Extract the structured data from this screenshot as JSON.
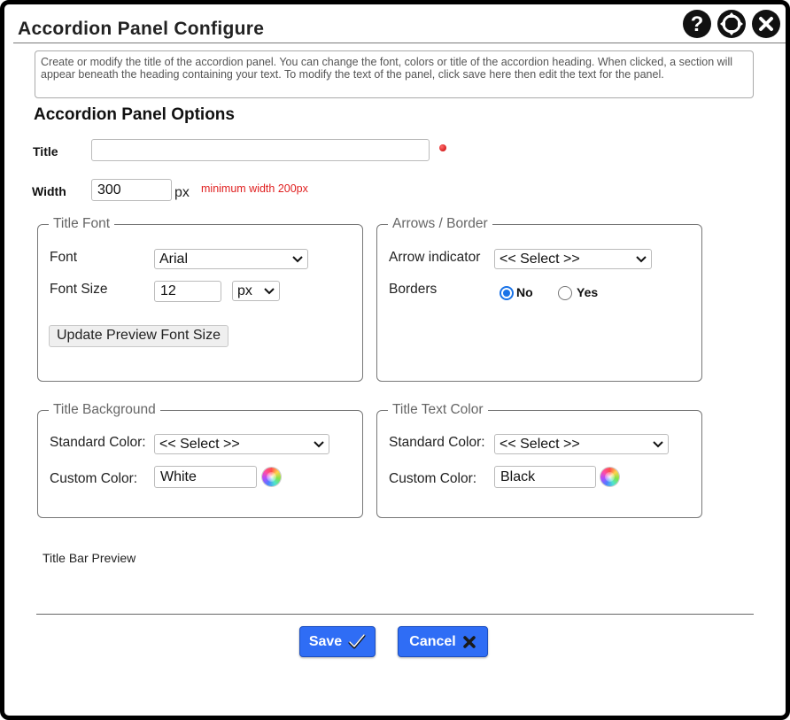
{
  "dialog": {
    "title": "Accordion Panel Configure",
    "header_icons": [
      "help-icon",
      "move-icon",
      "close-icon"
    ]
  },
  "info_text": "Create or modify the title of the accordion panel. You can change the font, colors or title of the accordion heading. When clicked, a section will appear beneath the heading containing your text. To modify the text of the panel, click save here then edit the text for the panel.",
  "options_heading": "Accordion Panel Options",
  "title_field": {
    "label": "Title",
    "value": ""
  },
  "width_field": {
    "label": "Width",
    "value": "300",
    "unit": "px",
    "hint": "minimum width 200px"
  },
  "title_font": {
    "legend": "Title Font",
    "font_label": "Font",
    "font_value": "Arial",
    "size_label": "Font Size",
    "size_value": "12",
    "size_unit": "px",
    "update_button": "Update Preview Font Size"
  },
  "arrows_border": {
    "legend": "Arrows / Border",
    "arrow_label": "Arrow indicator",
    "arrow_value": "<< Select >>",
    "borders_label": "Borders",
    "option_no": "No",
    "option_yes": "Yes",
    "selected": "No"
  },
  "title_background": {
    "legend": "Title Background",
    "standard_label": "Standard Color:",
    "standard_value": "<< Select >>",
    "custom_label": "Custom Color:",
    "custom_value": "White"
  },
  "title_text_color": {
    "legend": "Title Text Color",
    "standard_label": "Standard Color:",
    "standard_value": "<< Select >>",
    "custom_label": "Custom Color:",
    "custom_value": "Black"
  },
  "preview_label": "Title Bar Preview",
  "buttons": {
    "save": "Save",
    "cancel": "Cancel"
  },
  "colors": {
    "accent": "#2f6df5",
    "required": "#c40000",
    "hint": "#e02020",
    "radio": "#1a73e8"
  }
}
